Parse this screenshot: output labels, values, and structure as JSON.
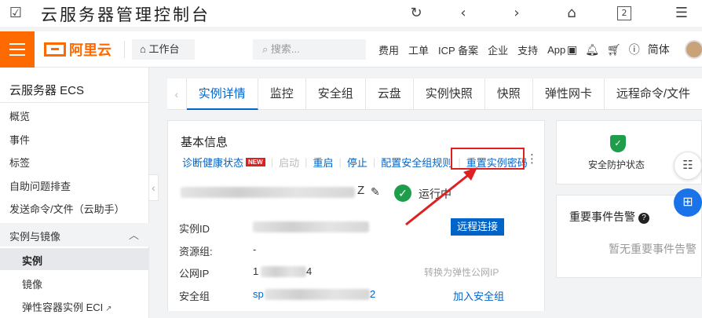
{
  "browser": {
    "title": "云服务器管理控制台",
    "tab_count": "2"
  },
  "topnav": {
    "brand": "阿里云",
    "workbench": "工作台",
    "search_placeholder": "搜索...",
    "links": [
      "费用",
      "工单",
      "ICP 备案",
      "企业",
      "支持",
      "App"
    ],
    "lang": "简体"
  },
  "sidebar": {
    "title": "云服务器 ECS",
    "items": [
      "概览",
      "事件",
      "标签",
      "自助问题排查",
      "发送命令/文件（云助手）"
    ],
    "group": "实例与镜像",
    "active": "实例",
    "sub_items": [
      "镜像",
      "弹性容器实例 ECI"
    ]
  },
  "tabs": [
    "实例详情",
    "监控",
    "安全组",
    "云盘",
    "实例快照",
    "快照",
    "弹性网卡",
    "远程命令/文件"
  ],
  "basic_info": {
    "title": "基本信息",
    "actions": {
      "diagnose": "诊断健康状态",
      "new_badge": "NEW",
      "start": "启动",
      "restart": "重启",
      "stop": "停止",
      "config_sg": "配置安全组规则",
      "reset_password": "重置实例密码"
    },
    "instance_name_suffix": "Z",
    "status": "运行中",
    "rows": {
      "instance_id_label": "实例ID",
      "resource_group_label": "资源组:",
      "resource_group_value": "-",
      "public_ip_label": "公网IP",
      "public_ip_prefix": "1",
      "public_ip_suffix": "4",
      "security_group_label": "安全组",
      "security_group_prefix": "sp",
      "security_group_suffix": "2"
    },
    "remote_connect": "远程连接",
    "convert_eip": "转换为弹性公网IP",
    "add_sg": "加入安全组"
  },
  "shield_card": {
    "label": "安全防护状态"
  },
  "events_card": {
    "title": "重要事件告警",
    "empty": "暂无重要事件告警"
  },
  "colors": {
    "brand_orange": "#ff6a00",
    "link_blue": "#0064c8",
    "status_green": "#1e9e4a",
    "annotation_red": "#e02020"
  }
}
